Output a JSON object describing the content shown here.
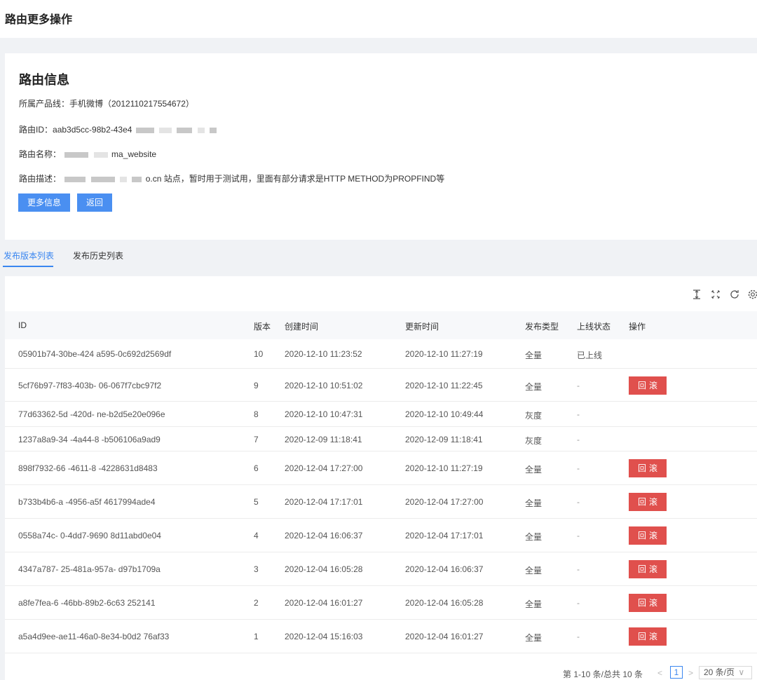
{
  "page": {
    "title": "路由更多操作"
  },
  "info": {
    "title": "路由信息",
    "product_line": "所属产品线：手机微博（2012110217554672）",
    "route_id_label": "路由ID：",
    "route_id_value": "aab3d5cc-98b2-43e4",
    "route_name_label": "路由名称：",
    "route_name_value": "ma_website",
    "route_desc_label": "路由描述：",
    "route_desc_value": "o.cn 站点，暂时用于测试用，里面有部分请求是HTTP METHOD为PROPFIND等",
    "more_button": "更多信息",
    "back_button": "返回"
  },
  "tabs": [
    {
      "label": "发布版本列表",
      "active": true
    },
    {
      "label": "发布历史列表",
      "active": false
    }
  ],
  "toolbar": {
    "icons": [
      "column-height-icon",
      "fullscreen-icon",
      "reload-icon",
      "settings-icon"
    ]
  },
  "table": {
    "columns": [
      "ID",
      "版本",
      "创建时间",
      "更新时间",
      "发布类型",
      "上线状态",
      "操作"
    ],
    "rows": [
      {
        "id": "05901b74-30be-424  a595-0c692d2569df",
        "version": "10",
        "created": "2020-12-10 11:23:52",
        "updated": "2020-12-10 11:27:19",
        "type": "全量",
        "status": "已上线",
        "action": ""
      },
      {
        "id": "5cf76b97-7f83-403b-  06-067f7cbc97f2",
        "version": "9",
        "created": "2020-12-10 10:51:02",
        "updated": "2020-12-10 11:22:45",
        "type": "全量",
        "status": "-",
        "action": "回滚"
      },
      {
        "id": "77d63362-5d  -420d-  ne-b2d5e20e096e",
        "version": "8",
        "created": "2020-12-10 10:47:31",
        "updated": "2020-12-10 10:49:44",
        "type": "灰度",
        "status": "-",
        "action": ""
      },
      {
        "id": "1237a8a9-34  -4a44-8  -b506106a9ad9",
        "version": "7",
        "created": "2020-12-09 11:18:41",
        "updated": "2020-12-09 11:18:41",
        "type": "灰度",
        "status": "-",
        "action": ""
      },
      {
        "id": "898f7932-66  -4611-8  -4228631d8483",
        "version": "6",
        "created": "2020-12-04 17:27:00",
        "updated": "2020-12-10 11:27:19",
        "type": "全量",
        "status": "-",
        "action": "回滚"
      },
      {
        "id": "b733b4b6-a  -4956-a5f  4617994ade4",
        "version": "5",
        "created": "2020-12-04 17:17:01",
        "updated": "2020-12-04 17:27:00",
        "type": "全量",
        "status": "-",
        "action": "回滚"
      },
      {
        "id": "0558a74c-  0-4dd7-9690  8d11abd0e04",
        "version": "4",
        "created": "2020-12-04 16:06:37",
        "updated": "2020-12-04 17:17:01",
        "type": "全量",
        "status": "-",
        "action": "回滚"
      },
      {
        "id": "4347a787-  25-481a-957a-  d97b1709a",
        "version": "3",
        "created": "2020-12-04 16:05:28",
        "updated": "2020-12-04 16:06:37",
        "type": "全量",
        "status": "-",
        "action": "回滚"
      },
      {
        "id": "a8fe7fea-6  -46bb-89b2-6c63  252141",
        "version": "2",
        "created": "2020-12-04 16:01:27",
        "updated": "2020-12-04 16:05:28",
        "type": "全量",
        "status": "-",
        "action": "回滚"
      },
      {
        "id": "a5a4d9ee-ae11-46a0-8e34-b0d2  76af33",
        "version": "1",
        "created": "2020-12-04 15:16:03",
        "updated": "2020-12-04 16:01:27",
        "type": "全量",
        "status": "-",
        "action": "回滚"
      }
    ]
  },
  "pagination": {
    "summary": "第 1-10 条/总共 10 条",
    "prev": "<",
    "current": "1",
    "next": ">",
    "page_size": "20 条/页",
    "page_size_chevron": "∨"
  }
}
